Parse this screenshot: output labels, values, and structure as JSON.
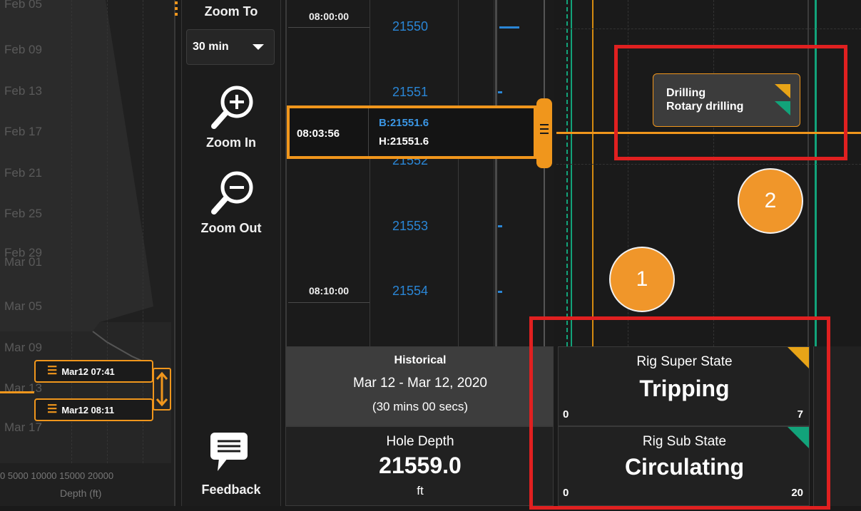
{
  "timeline": {
    "dates": [
      "Feb 05",
      "Feb 09",
      "Feb 13",
      "Feb 17",
      "Feb 21",
      "Feb 25",
      "Feb 29",
      "Mar 01",
      "Mar 05",
      "Mar 09",
      "Mar 13",
      "Mar 17"
    ],
    "range_start": "Mar12 07:41",
    "range_end": "Mar12 08:11",
    "axis_ticks": "0    5000  10000 15000 20000",
    "axis_title": "Depth (ft)"
  },
  "tools": {
    "zoom_to_label": "Zoom To",
    "zoom_select_value": "30 min",
    "zoom_in_label": "Zoom In",
    "zoom_out_label": "Zoom Out",
    "feedback_label": "Feedback"
  },
  "log": {
    "times": [
      "08:00:00",
      "08:10:00"
    ],
    "depths": [
      "21550",
      "21551",
      "21553",
      "21554"
    ],
    "partial_depth": "21552",
    "cursor_time": "08:03:56",
    "cursor_bit_depth": "B:21551.6",
    "cursor_hole_depth": "H:21551.6"
  },
  "activity_badge": {
    "line1": "Drilling",
    "line2": "Rotary drilling"
  },
  "callouts": [
    "1",
    "2"
  ],
  "historical": {
    "title": "Historical",
    "range": "Mar 12 - Mar 12, 2020",
    "duration": "(30 mins 00 secs)"
  },
  "hole_depth": {
    "label": "Hole Depth",
    "value": "21559.0",
    "unit": "ft"
  },
  "rig_super_state": {
    "label": "Rig Super State",
    "value": "Tripping",
    "min": "0",
    "max": "7"
  },
  "rig_sub_state": {
    "label": "Rig Sub State",
    "value": "Circulating",
    "min": "0",
    "max": "20"
  },
  "colors": {
    "accent": "#f0961c",
    "depth_blue": "#2a86d6",
    "highlight_red": "#e02020",
    "state_green": "#12a37a",
    "state_amber": "#e8a417"
  }
}
